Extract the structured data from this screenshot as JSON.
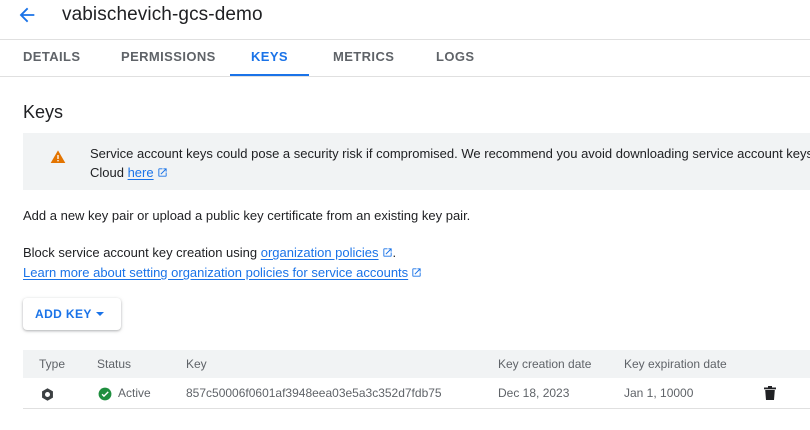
{
  "header": {
    "title": "vabischevich-gcs-demo"
  },
  "tabs": [
    {
      "label": "DETAILS"
    },
    {
      "label": "PERMISSIONS"
    },
    {
      "label": "KEYS"
    },
    {
      "label": "METRICS"
    },
    {
      "label": "LOGS"
    }
  ],
  "active_tab": "KEYS",
  "section": {
    "title": "Keys"
  },
  "banner": {
    "text_line1": "Service account keys could pose a security risk if compromised. We recommend you avoid downloading service account keys",
    "text_line2_prefix": "Cloud ",
    "link": "here"
  },
  "intro_text": "Add a new key pair or upload a public key certificate from an existing key pair.",
  "block_text": "Block service account key creation using ",
  "org_policies_link": "organization policies",
  "block_text_suffix": ".",
  "learn_more_link": "Learn more about setting organization policies for service accounts",
  "add_key_button": "ADD KEY",
  "table": {
    "headers": [
      "Type",
      "Status",
      "Key",
      "Key creation date",
      "Key expiration date"
    ],
    "rows": [
      {
        "type_icon": "key-type-icon",
        "status": "Active",
        "key": "857c50006f0601af3948eea03e5a3c352d7fdb75",
        "created": "Dec 18, 2023",
        "expires": "Jan 1, 10000"
      }
    ]
  },
  "colors": {
    "accent": "#1a73e8",
    "warning": "#e37400",
    "success": "#1e8e3e",
    "banner_bg": "#f1f3f4"
  }
}
